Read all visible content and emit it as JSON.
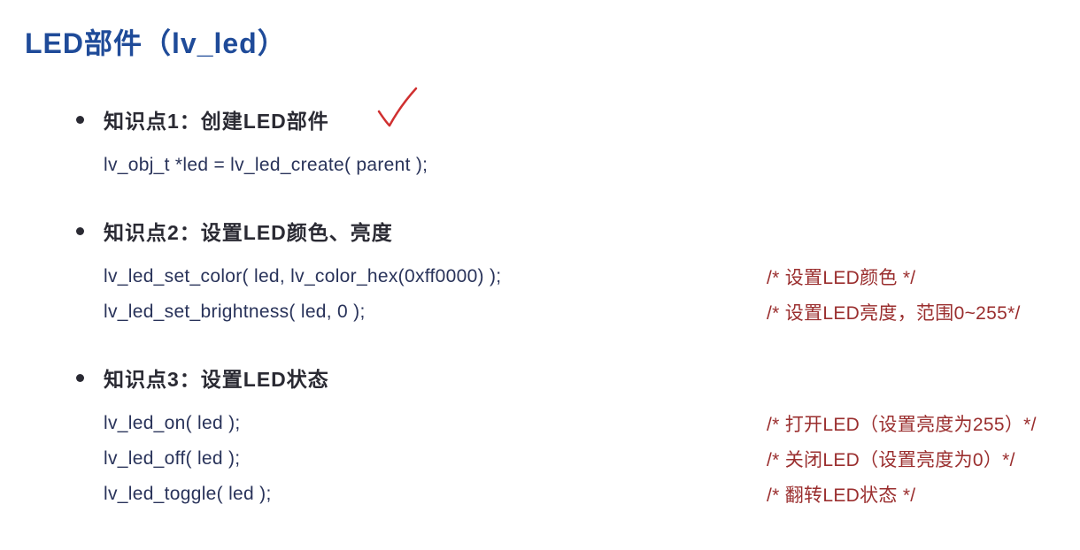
{
  "title": "LED部件（lv_led）",
  "sections": [
    {
      "heading": "知识点1：创建LED部件",
      "has_checkmark": true,
      "lines": [
        {
          "code": "lv_obj_t   *led = lv_led_create( parent );",
          "comment": ""
        }
      ]
    },
    {
      "heading": "知识点2：设置LED颜色、亮度",
      "has_checkmark": false,
      "lines": [
        {
          "code": "lv_led_set_color( led, lv_color_hex(0xff0000) );",
          "comment": "/* 设置LED颜色 */"
        },
        {
          "code": "lv_led_set_brightness( led, 0 );",
          "comment": "/* 设置LED亮度，范围0~255*/"
        }
      ]
    },
    {
      "heading": "知识点3：设置LED状态",
      "has_checkmark": false,
      "lines": [
        {
          "code": "lv_led_on( led );",
          "comment": "/* 打开LED（设置亮度为255）*/"
        },
        {
          "code": "lv_led_off( led );",
          "comment": "/* 关闭LED（设置亮度为0）*/"
        },
        {
          "code": "lv_led_toggle( led );",
          "comment": "/* 翻转LED状态 */"
        }
      ]
    }
  ]
}
